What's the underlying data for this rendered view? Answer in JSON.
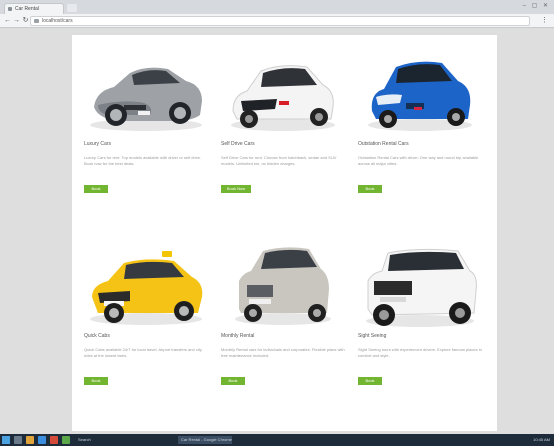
{
  "browser": {
    "tab_title": "Car Rental",
    "url": "localhost/cars",
    "window_controls": "– ▢ ✕",
    "menu_icon": "⋮"
  },
  "cars": [
    {
      "name": "Luxury Cars",
      "description": "Luxury Cars for rent. Top models available with driver or self drive. Book now for the best deals.",
      "button": "Book"
    },
    {
      "name": "Self Drive Cars",
      "description": "Self Drive Cars for rent. Choose from hatchback, sedan and SUV models. Unlimited km, no hidden charges.",
      "button": "Book Now"
    },
    {
      "name": "Outstation Rental Cars",
      "description": "Outstation Rental Cars with driver. One way and round trip available across all major cities.",
      "button": "Book"
    },
    {
      "name": "Quick Cabs",
      "description": "Quick Cabs available 24/7 for local travel. Airport transfers and city rides at the lowest fares.",
      "button": "Book"
    },
    {
      "name": "Monthly Rental",
      "description": "Monthly Rental cars for individuals and corporates. Flexible plans with free maintenance included.",
      "button": "Book"
    },
    {
      "name": "Sight Seeing",
      "description": "Sight Seeing tours with experienced drivers. Explore famous places in comfort and style.",
      "button": "Book"
    }
  ],
  "colors": {
    "book_button": "#72b530",
    "page_background": "#dedede",
    "card_background": "#ffffff"
  },
  "taskbar": {
    "items": [
      "Search",
      "Car Rental - Google Chrome"
    ],
    "clock": "10:45 AM"
  }
}
